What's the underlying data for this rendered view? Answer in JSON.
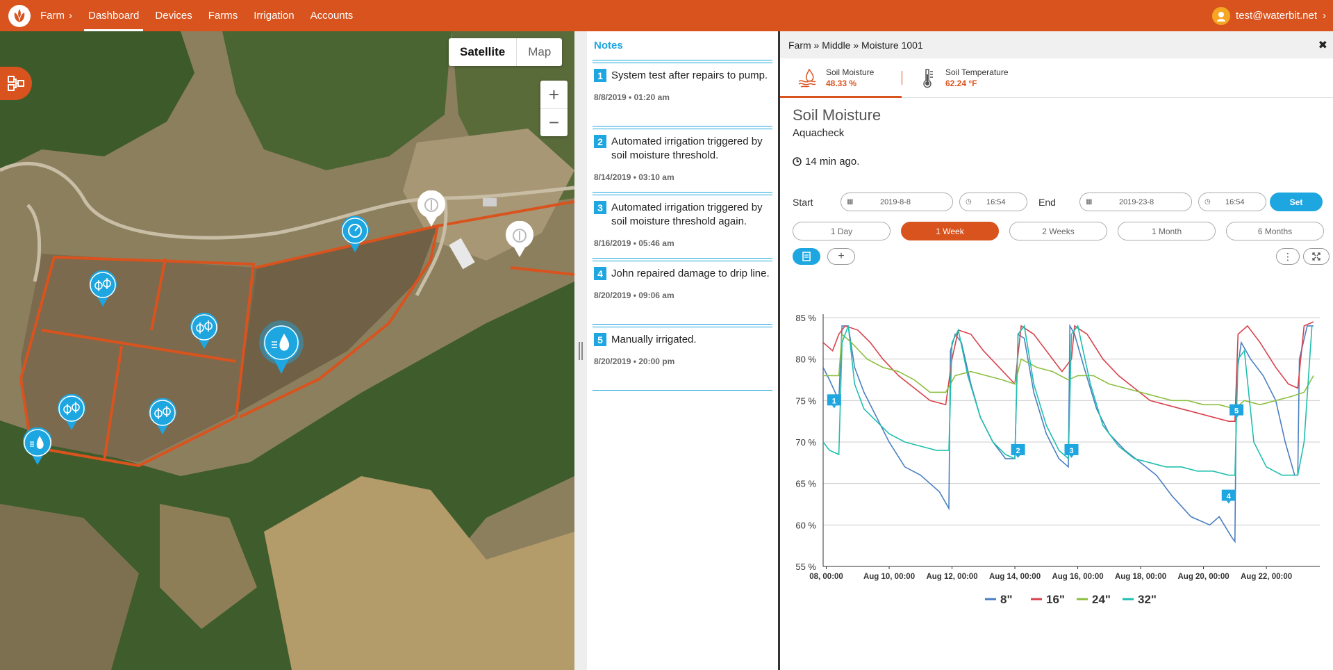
{
  "nav": {
    "farm": "Farm",
    "items": [
      "Dashboard",
      "Devices",
      "Farms",
      "Irrigation",
      "Accounts"
    ],
    "active": "Dashboard",
    "user": "test@waterbit.net"
  },
  "map": {
    "toggle": {
      "satellite": "Satellite",
      "map": "Map"
    },
    "zoom_in": "+",
    "zoom_out": "−"
  },
  "notes": {
    "title": "Notes",
    "items": [
      {
        "num": "1",
        "text": "System test after repairs to pump.",
        "date": "8/8/2019 • 01:20 am"
      },
      {
        "num": "2",
        "text": "Automated irrigation triggered by soil moisture threshold.",
        "date": "8/14/2019 • 03:10 am"
      },
      {
        "num": "3",
        "text": "Automated irrigation triggered by soil moisture threshold again.",
        "date": "8/16/2019 • 05:46 am"
      },
      {
        "num": "4",
        "text": "John repaired damage to drip line.",
        "date": "8/20/2019 • 09:06 am"
      },
      {
        "num": "5",
        "text": "Manually irrigated.",
        "date": "8/20/2019 • 20:00 pm"
      }
    ]
  },
  "panel": {
    "breadcrumb": "Farm » Middle » Moisture 1001",
    "close": "✖",
    "tabs": [
      {
        "label": "Soil Moisture",
        "value": "48.33 %"
      },
      {
        "label": "Soil Temperature",
        "value": "62.24 °F"
      }
    ],
    "title": "Soil Moisture",
    "subtitle": "Aquacheck",
    "updated": "14 min ago.",
    "start_label": "Start",
    "start_date": "2019-8-8",
    "start_time": "16:54",
    "end_label": "End",
    "end_date": "2019-23-8",
    "end_time": "16:54",
    "set_label": "Set",
    "periods": [
      "1 Day",
      "1 Week",
      "2 Weeks",
      "1 Month",
      "6 Months"
    ],
    "active_period": "1 Week"
  },
  "colors": {
    "brand": "#d9531e",
    "accent": "#1ea6e0"
  },
  "chart_data": {
    "type": "line",
    "ylim": [
      55,
      85
    ],
    "y_ticks": [
      "85 %",
      "80 %",
      "75 %",
      "70 %",
      "65 %",
      "60 %",
      "55 %"
    ],
    "x_ticks": [
      "08, 00:00",
      "Aug 10, 00:00",
      "Aug 12, 00:00",
      "Aug 14, 00:00",
      "Aug 16, 00:00",
      "Aug 18, 00:00",
      "Aug 20, 00:00",
      "Aug 22, 00:00"
    ],
    "x_range_days": [
      7.9,
      23.7
    ],
    "legend": "bottom",
    "series": [
      {
        "name": "8\"",
        "color": "#4a7fc1",
        "points": [
          [
            7.9,
            79
          ],
          [
            8.1,
            77.5
          ],
          [
            8.4,
            75
          ],
          [
            8.5,
            84
          ],
          [
            8.7,
            84
          ],
          [
            8.9,
            79
          ],
          [
            9.2,
            76
          ],
          [
            9.6,
            73
          ],
          [
            10.0,
            70
          ],
          [
            10.5,
            67
          ],
          [
            11.0,
            66
          ],
          [
            11.3,
            65
          ],
          [
            11.6,
            64
          ],
          [
            11.9,
            62
          ],
          [
            11.95,
            81
          ],
          [
            12.1,
            83
          ],
          [
            12.3,
            82
          ],
          [
            12.6,
            77
          ],
          [
            12.9,
            73
          ],
          [
            13.3,
            70
          ],
          [
            13.7,
            68
          ],
          [
            14.0,
            68
          ],
          [
            14.1,
            83
          ],
          [
            14.3,
            82.5
          ],
          [
            14.6,
            76
          ],
          [
            15.0,
            71
          ],
          [
            15.4,
            68
          ],
          [
            15.7,
            67
          ],
          [
            15.75,
            84
          ],
          [
            15.9,
            83
          ],
          [
            16.2,
            79
          ],
          [
            16.6,
            74
          ],
          [
            17.0,
            71
          ],
          [
            17.5,
            69
          ],
          [
            18.0,
            67.5
          ],
          [
            18.5,
            66
          ],
          [
            19.0,
            63.5
          ],
          [
            19.6,
            61
          ],
          [
            20.2,
            60
          ],
          [
            20.5,
            61
          ],
          [
            20.9,
            58.5
          ],
          [
            21.0,
            58
          ],
          [
            21.05,
            78
          ],
          [
            21.2,
            82
          ],
          [
            21.5,
            80
          ],
          [
            21.9,
            78
          ],
          [
            22.3,
            75
          ],
          [
            22.6,
            70
          ],
          [
            22.9,
            66
          ],
          [
            23.0,
            66
          ],
          [
            23.05,
            80
          ],
          [
            23.3,
            84
          ],
          [
            23.5,
            84
          ]
        ]
      },
      {
        "name": "16\"",
        "color": "#d9414b",
        "points": [
          [
            7.9,
            82
          ],
          [
            8.2,
            81
          ],
          [
            8.4,
            83
          ],
          [
            8.6,
            84
          ],
          [
            9.0,
            83.5
          ],
          [
            9.4,
            82
          ],
          [
            9.8,
            80
          ],
          [
            10.3,
            78
          ],
          [
            10.8,
            76.5
          ],
          [
            11.3,
            75
          ],
          [
            11.8,
            74.5
          ],
          [
            12.0,
            80
          ],
          [
            12.2,
            83.5
          ],
          [
            12.6,
            83
          ],
          [
            13.0,
            81
          ],
          [
            13.5,
            79
          ],
          [
            14.0,
            77
          ],
          [
            14.2,
            84
          ],
          [
            14.6,
            83
          ],
          [
            15.0,
            81
          ],
          [
            15.5,
            78.5
          ],
          [
            15.8,
            80
          ],
          [
            15.9,
            84
          ],
          [
            16.3,
            83
          ],
          [
            16.8,
            80
          ],
          [
            17.3,
            78
          ],
          [
            17.8,
            76.5
          ],
          [
            18.3,
            75
          ],
          [
            18.8,
            74.5
          ],
          [
            19.3,
            74
          ],
          [
            19.8,
            73.5
          ],
          [
            20.3,
            73
          ],
          [
            20.8,
            72.5
          ],
          [
            21.0,
            72.5
          ],
          [
            21.1,
            83
          ],
          [
            21.4,
            84
          ],
          [
            21.8,
            82
          ],
          [
            22.3,
            79
          ],
          [
            22.7,
            77
          ],
          [
            23.0,
            76.5
          ],
          [
            23.2,
            84
          ],
          [
            23.5,
            84.5
          ]
        ]
      },
      {
        "name": "24\"",
        "color": "#8cbf3f",
        "points": [
          [
            7.9,
            78
          ],
          [
            8.4,
            78
          ],
          [
            8.5,
            83
          ],
          [
            8.8,
            82
          ],
          [
            9.3,
            80
          ],
          [
            9.8,
            79
          ],
          [
            10.3,
            78.5
          ],
          [
            10.8,
            77.5
          ],
          [
            11.3,
            76
          ],
          [
            11.8,
            76
          ],
          [
            12.1,
            78
          ],
          [
            12.6,
            78.5
          ],
          [
            13.1,
            78
          ],
          [
            13.6,
            77.5
          ],
          [
            14.0,
            77
          ],
          [
            14.2,
            80
          ],
          [
            14.7,
            79
          ],
          [
            15.2,
            78.5
          ],
          [
            15.7,
            77.5
          ],
          [
            16.0,
            78
          ],
          [
            16.5,
            78
          ],
          [
            17.0,
            77
          ],
          [
            17.5,
            76.5
          ],
          [
            18.0,
            76
          ],
          [
            18.5,
            75.5
          ],
          [
            19.0,
            75
          ],
          [
            19.5,
            75
          ],
          [
            20.0,
            74.5
          ],
          [
            20.5,
            74.5
          ],
          [
            21.0,
            74
          ],
          [
            21.3,
            75
          ],
          [
            21.8,
            74.5
          ],
          [
            22.3,
            75
          ],
          [
            22.8,
            75.5
          ],
          [
            23.2,
            76
          ],
          [
            23.5,
            78
          ]
        ]
      },
      {
        "name": "32\"",
        "color": "#1fbfae",
        "points": [
          [
            7.9,
            70
          ],
          [
            8.1,
            69
          ],
          [
            8.4,
            68.5
          ],
          [
            8.5,
            82
          ],
          [
            8.7,
            84
          ],
          [
            8.9,
            77
          ],
          [
            9.2,
            74
          ],
          [
            9.6,
            72.5
          ],
          [
            10.0,
            71
          ],
          [
            10.5,
            70
          ],
          [
            11.0,
            69.5
          ],
          [
            11.5,
            69
          ],
          [
            11.9,
            69
          ],
          [
            12.0,
            82
          ],
          [
            12.2,
            83.5
          ],
          [
            12.5,
            78
          ],
          [
            12.9,
            73
          ],
          [
            13.3,
            70
          ],
          [
            13.7,
            68.5
          ],
          [
            14.0,
            68
          ],
          [
            14.1,
            83
          ],
          [
            14.3,
            84
          ],
          [
            14.6,
            77
          ],
          [
            15.0,
            72
          ],
          [
            15.4,
            69
          ],
          [
            15.7,
            68
          ],
          [
            15.8,
            83
          ],
          [
            16.0,
            84
          ],
          [
            16.4,
            77
          ],
          [
            16.8,
            72
          ],
          [
            17.3,
            69.5
          ],
          [
            17.8,
            68
          ],
          [
            18.3,
            67.5
          ],
          [
            18.8,
            67
          ],
          [
            19.3,
            67
          ],
          [
            19.8,
            66.5
          ],
          [
            20.3,
            66.5
          ],
          [
            20.8,
            66
          ],
          [
            21.0,
            66
          ],
          [
            21.1,
            80
          ],
          [
            21.3,
            81
          ],
          [
            21.6,
            70
          ],
          [
            22.0,
            67
          ],
          [
            22.5,
            66
          ],
          [
            23.0,
            66
          ],
          [
            23.2,
            70
          ],
          [
            23.45,
            84
          ]
        ]
      }
    ],
    "markers": [
      {
        "label": "1",
        "x": 8.25,
        "y": 75
      },
      {
        "label": "2",
        "x": 14.1,
        "y": 69
      },
      {
        "label": "3",
        "x": 15.8,
        "y": 69
      },
      {
        "label": "4",
        "x": 20.8,
        "y": 63.5
      },
      {
        "label": "5",
        "x": 21.05,
        "y": 73.8
      }
    ]
  }
}
